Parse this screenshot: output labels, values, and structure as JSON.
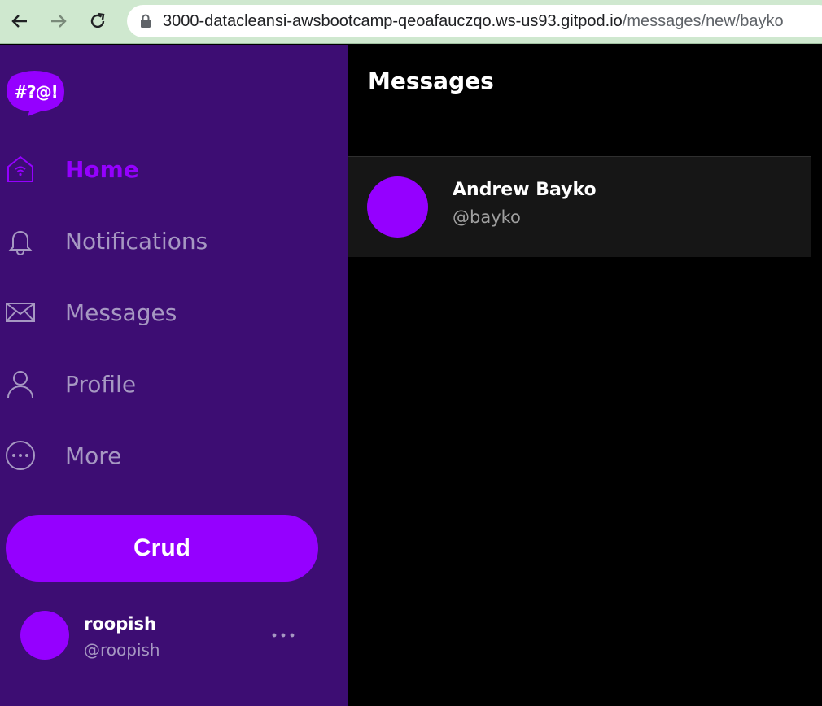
{
  "browser": {
    "url_host": "3000-datacleansi-awsbootcamp-qeoafauczqo.ws-us93.gitpod.io",
    "url_path": "/messages/new/bayko"
  },
  "sidebar": {
    "logo_text": "#?@!",
    "nav": [
      {
        "label": "Home",
        "icon": "home-icon",
        "active": true
      },
      {
        "label": "Notifications",
        "icon": "bell-icon"
      },
      {
        "label": "Messages",
        "icon": "envelope-icon"
      },
      {
        "label": "Profile",
        "icon": "user-icon"
      },
      {
        "label": "More",
        "icon": "more-circle-icon"
      }
    ],
    "crud_label": "Crud",
    "profile": {
      "name": "roopish",
      "handle": "@roopish"
    }
  },
  "main": {
    "title": "Messages",
    "conversations": [
      {
        "name": "Andrew Bayko",
        "handle": "@bayko"
      }
    ]
  },
  "colors": {
    "accent": "#9500ff",
    "sidebar_bg": "#3d0d73",
    "muted_text": "#a698c2"
  }
}
